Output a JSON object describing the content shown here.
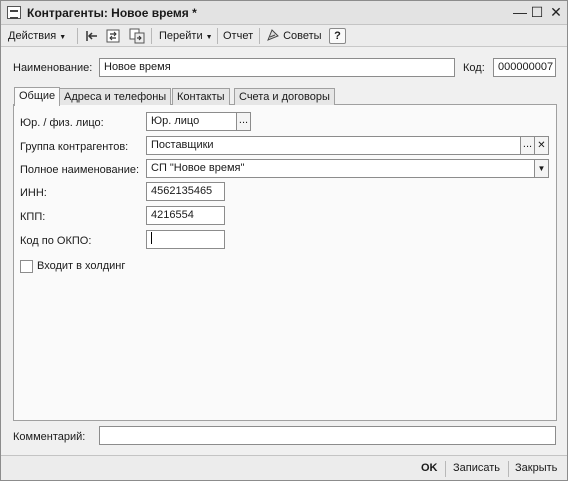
{
  "window": {
    "title": "Контрагенты: Новое время *",
    "minimize": "—",
    "maximize": "☐",
    "close": "✕"
  },
  "toolbar": {
    "actions_label": "Действия",
    "goto_label": "Перейти",
    "report_label": "Отчет",
    "tips_label": "Советы",
    "help_label": "?"
  },
  "header": {
    "name_label": "Наименование:",
    "name_value": "Новое время",
    "code_label": "Код:",
    "code_value": "000000007"
  },
  "tabs": [
    {
      "label": "Общие"
    },
    {
      "label": "Адреса и телефоны"
    },
    {
      "label": "Контакты"
    },
    {
      "label": "Счета и договоры"
    }
  ],
  "general": {
    "entity_type_label": "Юр. / физ. лицо:",
    "entity_type_value": "Юр. лицо",
    "group_label": "Группа контрагентов:",
    "group_value": "Поставщики",
    "full_name_label": "Полное наименование:",
    "full_name_value": "СП \"Новое время\"",
    "inn_label": "ИНН:",
    "inn_value": "4562135465",
    "kpp_label": "КПП:",
    "kpp_value": "4216554",
    "okpo_label": "Код по ОКПО:",
    "okpo_value": "",
    "holding_label": "Входит в холдинг",
    "holding_checked": false
  },
  "footer": {
    "comment_label": "Комментарий:",
    "comment_value": ""
  },
  "buttons": {
    "ok": "OK",
    "save": "Записать",
    "close": "Закрыть",
    "ellipsis": "...",
    "clear": "✕",
    "dropdown": "▼"
  }
}
